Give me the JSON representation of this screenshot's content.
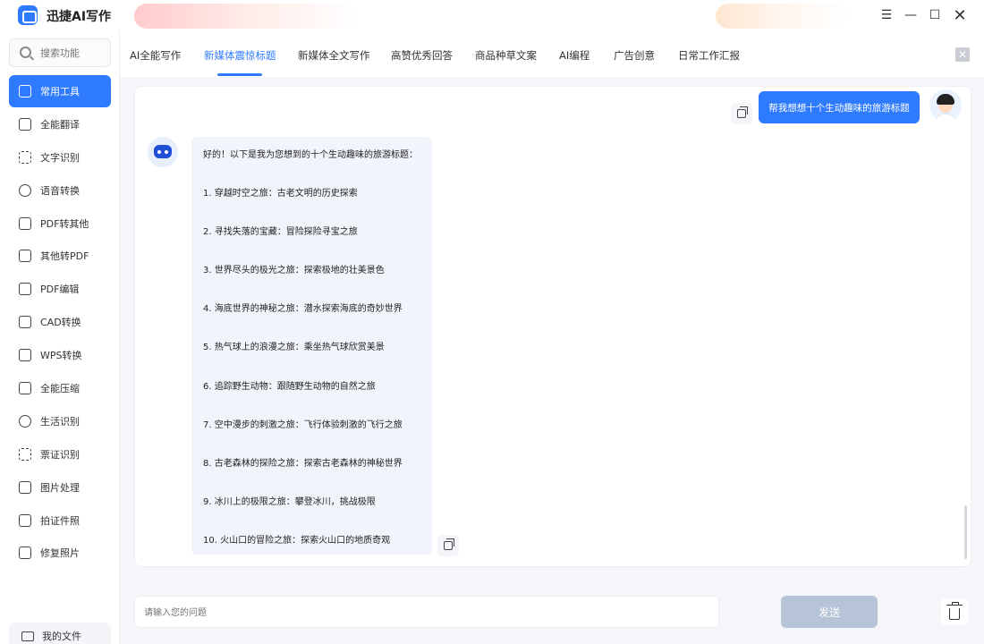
{
  "app": {
    "title": "迅捷AI写作"
  },
  "sidebar": {
    "search_placeholder": "搜索功能",
    "items": [
      {
        "label": "常用工具",
        "icon": "toolbox-icon",
        "active": true
      },
      {
        "label": "全能翻译",
        "icon": "translate-icon"
      },
      {
        "label": "文字识别",
        "icon": "text-scan-icon"
      },
      {
        "label": "语音转换",
        "icon": "voice-icon"
      },
      {
        "label": "PDF转其他",
        "icon": "pdf-convert-icon"
      },
      {
        "label": "其他转PDF",
        "icon": "to-pdf-icon"
      },
      {
        "label": "PDF编辑",
        "icon": "pdf-edit-icon"
      },
      {
        "label": "CAD转换",
        "icon": "cad-icon"
      },
      {
        "label": "WPS转换",
        "icon": "wps-icon"
      },
      {
        "label": "全能压缩",
        "icon": "compress-icon"
      },
      {
        "label": "生活识别",
        "icon": "life-scan-icon"
      },
      {
        "label": "票证识别",
        "icon": "ticket-scan-icon"
      },
      {
        "label": "图片处理",
        "icon": "image-icon"
      },
      {
        "label": "拍证件照",
        "icon": "id-photo-icon"
      },
      {
        "label": "修复照片",
        "icon": "photo-repair-icon"
      }
    ],
    "my_files": "我的文件"
  },
  "tabs": [
    {
      "label": "AI全能写作"
    },
    {
      "label": "新媒体震惊标题",
      "active": true
    },
    {
      "label": "新媒体全文写作"
    },
    {
      "label": "高赞优秀回答"
    },
    {
      "label": "商品种草文案"
    },
    {
      "label": "AI编程"
    },
    {
      "label": "广告创意"
    },
    {
      "label": "日常工作汇报"
    }
  ],
  "chat": {
    "user_message": "帮我想想十个生动趣味的旅游标题",
    "ai_lines": [
      "好的！以下是我为您想到的十个生动趣味的旅游标题：",
      "1. 穿越时空之旅：古老文明的历史探索",
      "2. 寻找失落的宝藏：冒险探险寻宝之旅",
      "3. 世界尽头的极光之旅：探索极地的壮美景色",
      "4. 海底世界的神秘之旅：潜水探索海底的奇妙世界",
      "5. 热气球上的浪漫之旅：乘坐热气球欣赏美景",
      "6. 追踪野生动物：跟随野生动物的自然之旅",
      "7. 空中漫步的刺激之旅：飞行体验刺激的飞行之旅",
      "8. 古老森林的探险之旅：探索古老森林的神秘世界",
      "9. 冰川上的极限之旅：攀登冰川，挑战极限",
      "10. 火山口的冒险之旅：探索火山口的地质奇观"
    ]
  },
  "input": {
    "placeholder": "请输入您的问题"
  },
  "send_label": "发送",
  "colors": {
    "accent": "#2f7bff",
    "send_disabled": "#b7c4d8"
  }
}
